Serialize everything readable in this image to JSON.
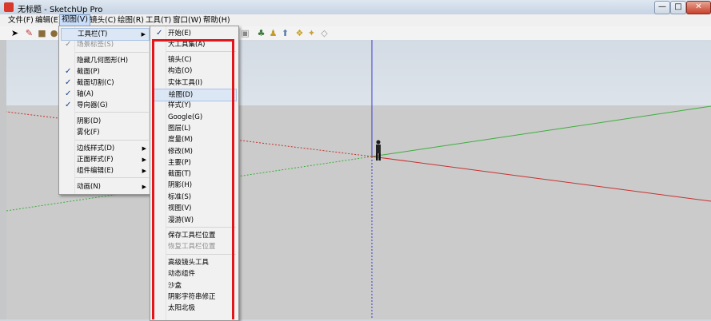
{
  "window": {
    "title": "无标题 - SketchUp Pro",
    "controls": {
      "minimize": "—",
      "maximize": "□",
      "close": "✕"
    }
  },
  "menubar": [
    {
      "label": "文件(F)"
    },
    {
      "label": "编辑(E)"
    },
    {
      "label": "视图(V)"
    },
    {
      "label": "镜头(C)"
    },
    {
      "label": "绘图(R)"
    },
    {
      "label": "工具(T)"
    },
    {
      "label": "窗口(W)"
    },
    {
      "label": "帮助(H)"
    }
  ],
  "view_menu": {
    "items": [
      {
        "label": "工具栏(T)",
        "submenu": true,
        "highlighted": true
      },
      {
        "label": "场景标签(S)",
        "checked": true,
        "disabled": true
      },
      {
        "label": "隐藏几何图形(H)"
      },
      {
        "label": "截面(P)",
        "checked": true
      },
      {
        "label": "截面切割(C)",
        "checked": true
      },
      {
        "label": "轴(A)",
        "checked": true
      },
      {
        "label": "导向器(G)",
        "checked": true
      },
      {
        "label": "阴影(D)"
      },
      {
        "label": "雾化(F)"
      },
      {
        "label": "边线样式(D)",
        "submenu": true
      },
      {
        "label": "正面样式(F)",
        "submenu": true
      },
      {
        "label": "组件编辑(E)",
        "submenu": true
      },
      {
        "label": "动画(N)",
        "submenu": true
      }
    ]
  },
  "toolbar_submenu": {
    "items": [
      {
        "label": "开始(E)",
        "checked": true
      },
      {
        "label": "大工具集(A)"
      },
      {
        "label": "镜头(C)"
      },
      {
        "label": "构造(O)"
      },
      {
        "label": "实体工具(I)"
      },
      {
        "label": "绘图(D)",
        "highlighted": true
      },
      {
        "label": "样式(Y)"
      },
      {
        "label": "Google(G)"
      },
      {
        "label": "图层(L)"
      },
      {
        "label": "度量(M)"
      },
      {
        "label": "修改(M)"
      },
      {
        "label": "主要(P)"
      },
      {
        "label": "截面(T)"
      },
      {
        "label": "阴影(H)"
      },
      {
        "label": "标准(S)"
      },
      {
        "label": "视图(V)"
      },
      {
        "label": "漫游(W)"
      },
      {
        "label": "保存工具栏位置"
      },
      {
        "label": "恢复工具栏位置",
        "disabled": true
      },
      {
        "label": "高级镜头工具"
      },
      {
        "label": "动态组件"
      },
      {
        "label": "沙盒"
      },
      {
        "label": "阴影字符串修正"
      },
      {
        "label": "太阳北极"
      }
    ]
  },
  "icons": {
    "check": "✓",
    "arrow": "▶"
  },
  "colors": {
    "highlight_box": "#e2151b",
    "axis_green": "#3fae3f",
    "axis_red": "#c83232",
    "axis_blue": "#3b3bd0"
  }
}
